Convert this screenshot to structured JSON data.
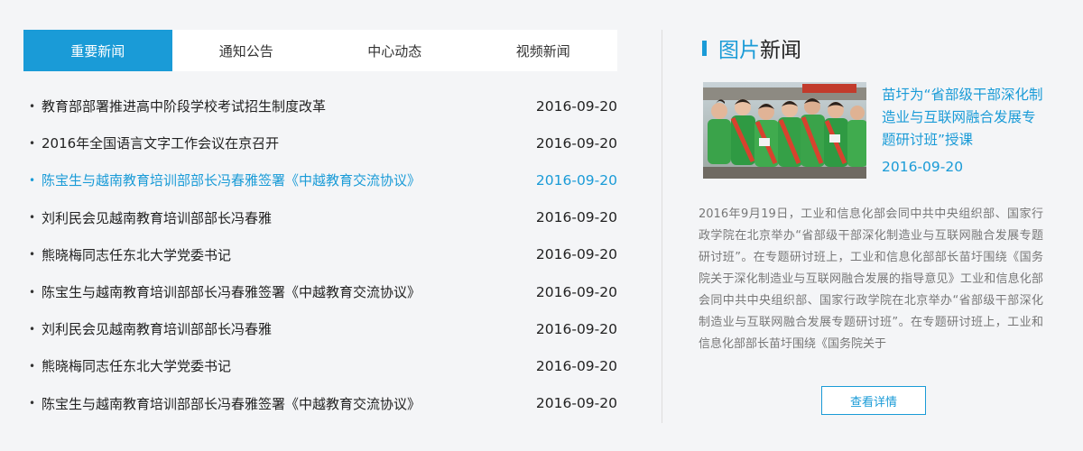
{
  "tabs": [
    {
      "label": "重要新闻",
      "active": true
    },
    {
      "label": "通知公告",
      "active": false
    },
    {
      "label": "中心动态",
      "active": false
    },
    {
      "label": "视频新闻",
      "active": false
    }
  ],
  "bullet": "•",
  "news": [
    {
      "title": "教育部部署推进高中阶段学校考试招生制度改革",
      "date": "2016-09-20",
      "highlight": false
    },
    {
      "title": "2016年全国语言文字工作会议在京召开",
      "date": "2016-09-20",
      "highlight": false
    },
    {
      "title": "陈宝生与越南教育培训部部长冯春雅签署《中越教育交流协议》",
      "date": "2016-09-20",
      "highlight": true
    },
    {
      "title": "刘利民会见越南教育培训部部长冯春雅",
      "date": "2016-09-20",
      "highlight": false
    },
    {
      "title": "熊晓梅同志任东北大学党委书记",
      "date": "2016-09-20",
      "highlight": false
    },
    {
      "title": "陈宝生与越南教育培训部部长冯春雅签署《中越教育交流协议》",
      "date": "2016-09-20",
      "highlight": false
    },
    {
      "title": "刘利民会见越南教育培训部部长冯春雅",
      "date": "2016-09-20",
      "highlight": false
    },
    {
      "title": "熊晓梅同志任东北大学党委书记",
      "date": "2016-09-20",
      "highlight": false
    },
    {
      "title": "陈宝生与越南教育培训部部长冯春雅签署《中越教育交流协议》",
      "date": "2016-09-20",
      "highlight": false
    }
  ],
  "picture_news": {
    "heading_blue": "图片",
    "heading_dark": "新闻",
    "title": "苗圩为“省部级干部深化制造业与互联网融合发展专题研讨班”授课",
    "date": "2016-09-20",
    "description": "2016年9月19日，工业和信息化部会同中共中央组织部、国家行政学院在北京举办“省部级干部深化制造业与互联网融合发展专题研讨班”。在专题研讨班上，工业和信息化部部长苗圩围绕《国务院关于深化制造业与互联网融合发展的指导意见》工业和信息化部会同中共中央组织部、国家行政学院在北京举办“省部级干部深化制造业与互联网融合发展专题研讨班”。在专题研讨班上，工业和信息化部部长苗圩围绕《国务院关于",
    "more_label": "查看详情"
  },
  "colors": {
    "accent": "#1a9bd7",
    "background": "#f4f5f7",
    "text": "#222222",
    "muted": "#777777"
  }
}
